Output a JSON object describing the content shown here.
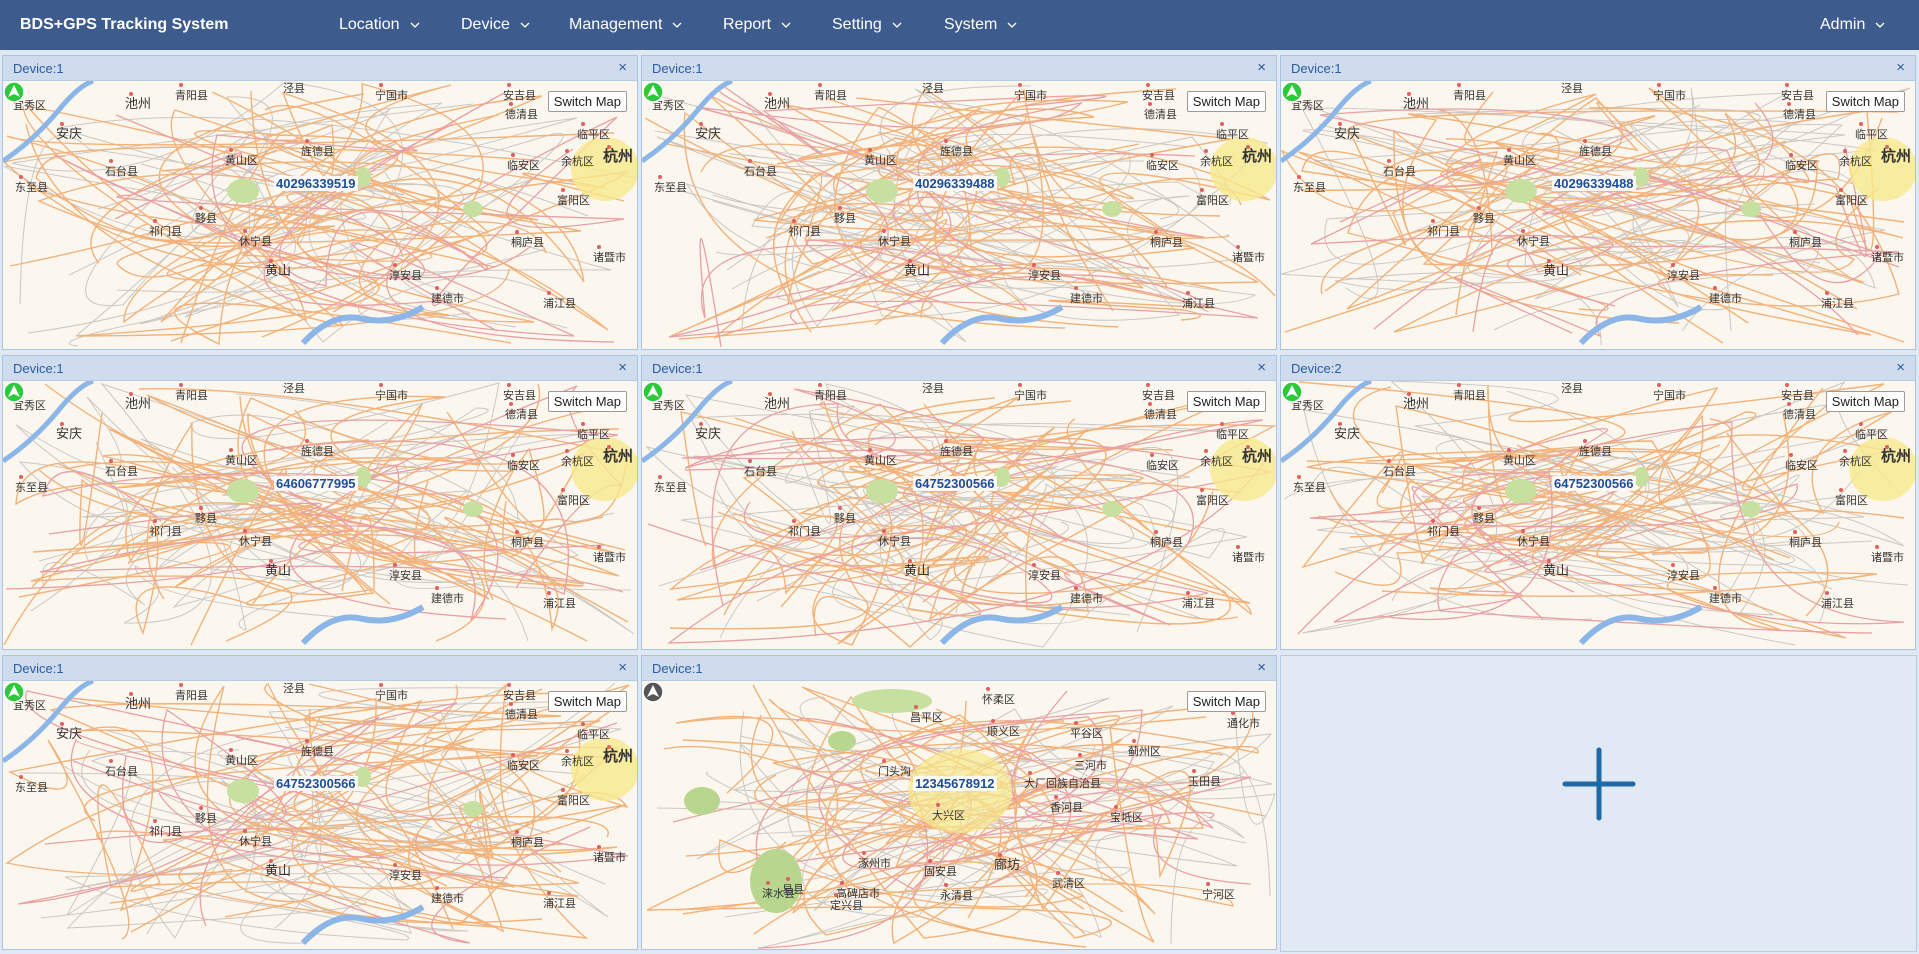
{
  "app": {
    "title": "BDS+GPS Tracking System"
  },
  "nav": {
    "items": [
      {
        "label": "Location"
      },
      {
        "label": "Device"
      },
      {
        "label": "Management"
      },
      {
        "label": "Report"
      },
      {
        "label": "Setting"
      },
      {
        "label": "System"
      }
    ],
    "user": "Admin"
  },
  "panels": [
    {
      "title": "Device:1",
      "close": "×",
      "switch_label": "Switch Map",
      "device_id": "40296339519",
      "marker_color": "#2cc93a",
      "map": "hangzhou"
    },
    {
      "title": "Device:1",
      "close": "×",
      "switch_label": "Switch Map",
      "device_id": "40296339488",
      "marker_color": "#2cc93a",
      "map": "hangzhou"
    },
    {
      "title": "Device:1",
      "close": "×",
      "switch_label": "Switch Map",
      "device_id": "40296339488",
      "marker_color": "#2cc93a",
      "map": "hangzhou"
    },
    {
      "title": "Device:1",
      "close": "×",
      "switch_label": "Switch Map",
      "device_id": "64606777995",
      "marker_color": "#2cc93a",
      "map": "hangzhou"
    },
    {
      "title": "Device:1",
      "close": "×",
      "switch_label": "Switch Map",
      "device_id": "64752300566",
      "marker_color": "#2cc93a",
      "map": "hangzhou"
    },
    {
      "title": "Device:2",
      "close": "×",
      "switch_label": "Switch Map",
      "device_id": "64752300566",
      "marker_color": "#2cc93a",
      "map": "hangzhou"
    },
    {
      "title": "Device:1",
      "close": "×",
      "switch_label": "Switch Map",
      "device_id": "64752300566",
      "marker_color": "#2cc93a",
      "map": "hangzhou"
    },
    {
      "title": "Device:1",
      "close": "×",
      "switch_label": "Switch Map",
      "device_id": "12345678912",
      "marker_color": "#555555",
      "map": "beijing"
    }
  ],
  "maps": {
    "hangzhou": {
      "cities": [
        {
          "name": "安庆",
          "big": false
        },
        {
          "name": "池州",
          "big": false
        },
        {
          "name": "宜秀区",
          "big": false
        },
        {
          "name": "青阳县",
          "big": false
        },
        {
          "name": "泾县",
          "big": false
        },
        {
          "name": "宁国市",
          "big": false
        },
        {
          "name": "安吉县",
          "big": false
        },
        {
          "name": "德清县",
          "big": false
        },
        {
          "name": "临平区",
          "big": false
        },
        {
          "name": "杭州",
          "big": true
        },
        {
          "name": "余杭区",
          "big": false
        },
        {
          "name": "临安区",
          "big": false
        },
        {
          "name": "富阳区",
          "big": false
        },
        {
          "name": "黄山区",
          "big": false
        },
        {
          "name": "旌德县",
          "big": false
        },
        {
          "name": "石台县",
          "big": false
        },
        {
          "name": "东至县",
          "big": false
        },
        {
          "name": "黟县",
          "big": false
        },
        {
          "name": "祁门县",
          "big": false
        },
        {
          "name": "休宁县",
          "big": false
        },
        {
          "name": "黄山",
          "big": false
        },
        {
          "name": "桐庐县",
          "big": false
        },
        {
          "name": "淳安县",
          "big": false
        },
        {
          "name": "建德市",
          "big": false
        },
        {
          "name": "浦江县",
          "big": false
        },
        {
          "name": "诸暨市",
          "big": false
        }
      ]
    },
    "beijing": {
      "cities": [
        {
          "name": "怀柔区",
          "big": false
        },
        {
          "name": "昌平区",
          "big": false
        },
        {
          "name": "顺义区",
          "big": false
        },
        {
          "name": "平谷区",
          "big": false
        },
        {
          "name": "通化市",
          "big": false
        },
        {
          "name": "三河市",
          "big": false
        },
        {
          "name": "蓟州区",
          "big": false
        },
        {
          "name": "门头沟",
          "big": false
        },
        {
          "name": "大厂回族自治县",
          "big": false
        },
        {
          "name": "玉田县",
          "big": false
        },
        {
          "name": "香河县",
          "big": false
        },
        {
          "name": "宝坻区",
          "big": false
        },
        {
          "name": "大兴区",
          "big": false
        },
        {
          "name": "涿州市",
          "big": false
        },
        {
          "name": "固安县",
          "big": false
        },
        {
          "name": "廊坊",
          "big": false
        },
        {
          "name": "武清区",
          "big": false
        },
        {
          "name": "高碑店市",
          "big": false
        },
        {
          "name": "易县",
          "big": false
        },
        {
          "name": "涞水县",
          "big": false
        },
        {
          "name": "定兴县",
          "big": false
        },
        {
          "name": "永清县",
          "big": false
        },
        {
          "name": "宁河区",
          "big": false
        }
      ]
    }
  },
  "add_panel": {
    "icon": "plus-icon"
  }
}
